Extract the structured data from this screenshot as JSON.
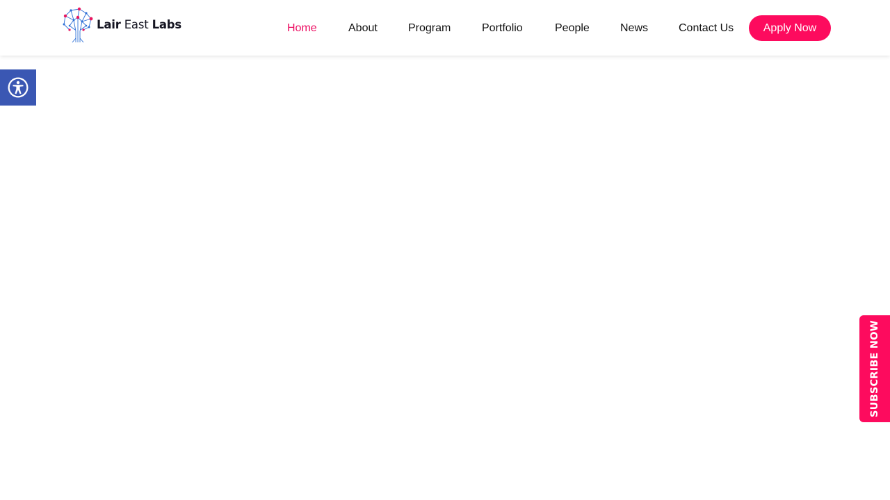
{
  "brand": {
    "name_part1": "Lair",
    "name_part2": "East",
    "name_part3": "Labs",
    "logo_icon": "tree-network-logo"
  },
  "nav": {
    "items": [
      {
        "label": "Home",
        "active": true
      },
      {
        "label": "About",
        "active": false
      },
      {
        "label": "Program",
        "active": false
      },
      {
        "label": "Portfolio",
        "active": false
      },
      {
        "label": "People",
        "active": false
      },
      {
        "label": "News",
        "active": false
      },
      {
        "label": "Contact Us",
        "active": false
      }
    ],
    "cta_label": "Apply Now"
  },
  "accessibility": {
    "icon": "accessibility-icon"
  },
  "subscribe": {
    "label": "SUBSCRIBE NOW"
  },
  "colors": {
    "accent": "#fd0b5e",
    "active_nav": "#ec0b60",
    "accessibility_bg": "#3a57b3",
    "logo_blue": "#2d6fd6",
    "logo_pink": "#e8165f",
    "text": "#111111",
    "background": "#ffffff"
  }
}
